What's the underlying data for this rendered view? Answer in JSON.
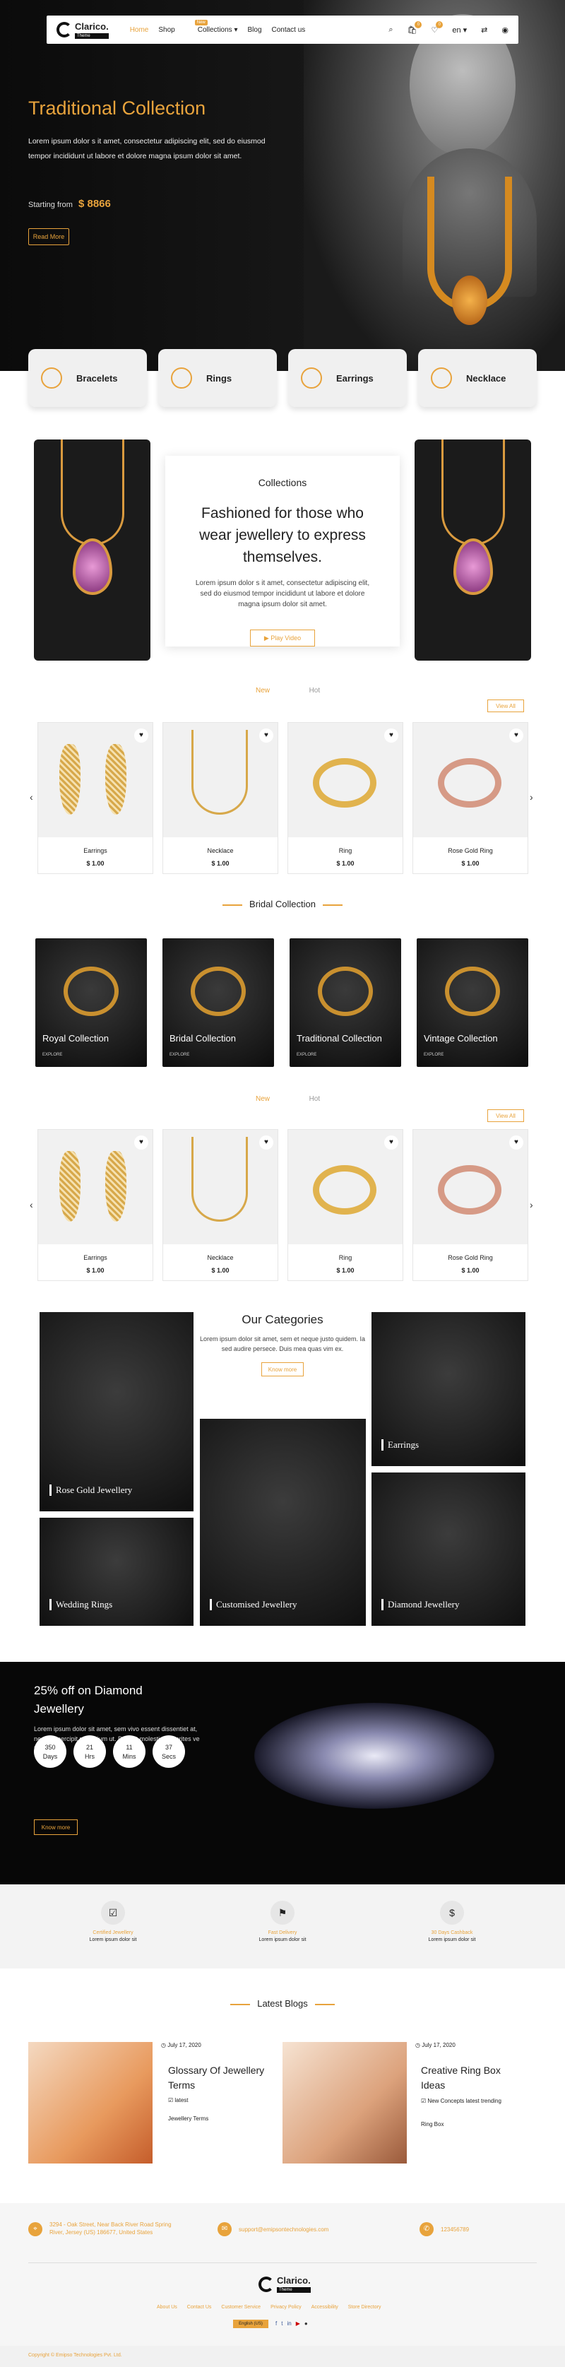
{
  "nav": {
    "brand": "Clarico.",
    "brand_tag": "Theme",
    "items": [
      "Home",
      "Shop",
      "Collections",
      "Blog",
      "Contact us"
    ],
    "new_badge": "New",
    "lang": "en",
    "cart_count": "0",
    "wish_count": "0"
  },
  "hero": {
    "title": "Traditional Collection",
    "text": "Lorem ipsum dolor s it amet, consectetur adipiscing elit, sed do eiusmod tempor incididunt ut labore et dolore magna ipsum dolor sit amet.",
    "starting_label": "Starting from",
    "price": "$ 8866",
    "button": "Read More"
  },
  "category_cards": [
    "Bracelets",
    "Rings",
    "Earrings",
    "Necklace"
  ],
  "collections": {
    "subtitle": "Collections",
    "heading": "Fashioned for those who wear jewellery to express themselves.",
    "text": "Lorem ipsum dolor s it amet, consectetur adipiscing elit, sed do eiusmod tempor incididunt ut labore et dolore magna ipsum dolor sit amet.",
    "button": "▶ Play Video"
  },
  "tabs1": {
    "new": "New",
    "hot": "Hot",
    "view_all": "View All"
  },
  "products1": [
    {
      "name": "Earrings",
      "price": "$ 1.00"
    },
    {
      "name": "Necklace",
      "price": "$ 1.00"
    },
    {
      "name": "Ring",
      "price": "$ 1.00"
    },
    {
      "name": "Rose Gold Ring",
      "price": "$ 1.00"
    }
  ],
  "bridal": {
    "heading": "Bridal Collection",
    "items": [
      {
        "title": "Royal Collection",
        "explore": "EXPLORE"
      },
      {
        "title": "Bridal Collection",
        "explore": "EXPLORE"
      },
      {
        "title": "Traditional Collection",
        "explore": "EXPLORE"
      },
      {
        "title": "Vintage Collection",
        "explore": "EXPLORE"
      }
    ]
  },
  "tabs2": {
    "new": "New",
    "hot": "Hot",
    "view_all": "View All"
  },
  "products2": [
    {
      "name": "Earrings",
      "price": "$ 1.00"
    },
    {
      "name": "Necklace",
      "price": "$ 1.00"
    },
    {
      "name": "Ring",
      "price": "$ 1.00"
    },
    {
      "name": "Rose Gold Ring",
      "price": "$ 1.00"
    }
  ],
  "our_categories": {
    "heading": "Our Categories",
    "text": "Lorem ipsum dolor sit amet, sem et neque justo quidem. Ia sed audire persece. Duis mea quas vim ex.",
    "button": "Know more",
    "items": [
      "Rose Gold Jewellery",
      "Earrings",
      "Wedding Rings",
      "Customised Jewellery",
      "Diamond Jewellery"
    ]
  },
  "deal": {
    "title": "25% off on Diamond Jewellery",
    "text": "Lorem ipsum dolor sit amet, sem vivo essent dissentiet at, nec falli percipit petentium ut. Delenit molestie verterites ve his...",
    "countdown": [
      {
        "value": "350",
        "unit": "Days"
      },
      {
        "value": "21",
        "unit": "Hrs"
      },
      {
        "value": "11",
        "unit": "Mins"
      },
      {
        "value": "37",
        "unit": "Secs"
      }
    ],
    "button": "Know more"
  },
  "features": [
    {
      "title": "Certified Jewellery",
      "desc": "Lorem ipsum dolor sit"
    },
    {
      "title": "Fast Delivery",
      "desc": "Lorem ipsum dolor sit"
    },
    {
      "title": "30 Days Cashback",
      "desc": "Lorem ipsum dolor sit"
    }
  ],
  "blogs": {
    "heading": "Latest Blogs",
    "items": [
      {
        "date": "July 17, 2020",
        "title": "Glossary Of Jewellery Terms",
        "tags": "latest",
        "category": "Jewellery Terms"
      },
      {
        "date": "July 17, 2020",
        "title": "Creative Ring Box Ideas",
        "tags": "New Concepts  latest  trending",
        "category": "Ring Box"
      }
    ]
  },
  "footer": {
    "address": "3294 - Oak Street, Near Back River Road Spring River, Jersey (US) 186677, United States",
    "email": "support@emipsontechnologies.com",
    "phone": "123456789",
    "links": [
      "About Us",
      "Contact Us",
      "Customer Service",
      "Privacy Policy",
      "Accessibility",
      "Store Directory"
    ],
    "lang_button": "English (US)",
    "copyright": "Copyright © Emipso Technologies Pvt. Ltd."
  }
}
